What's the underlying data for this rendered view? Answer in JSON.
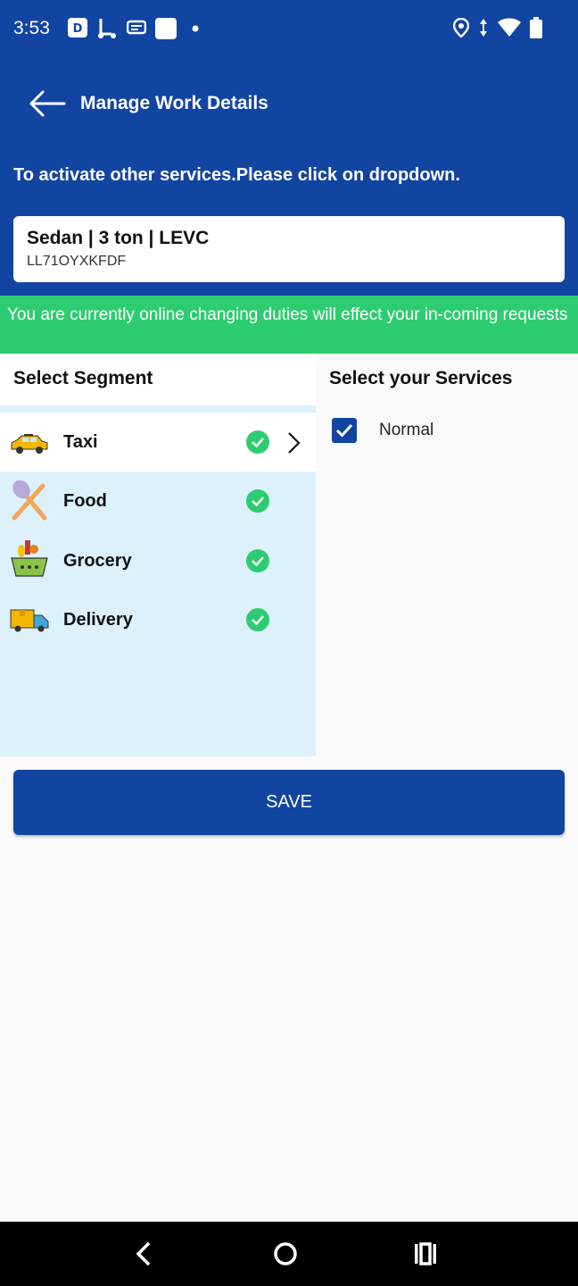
{
  "status_bar": {
    "time": "3:53",
    "icons": [
      "notification-p-icon",
      "scooter-icon",
      "message-icon",
      "square-icon",
      "dot-icon",
      "location-icon",
      "data-arrows-icon",
      "wifi-icon",
      "battery-icon"
    ]
  },
  "header": {
    "title": "Manage Work Details",
    "instruction": "To activate other services.Please click on dropdown."
  },
  "vehicle": {
    "name": "Sedan | 3 ton | LEVC",
    "plate": "LL71OYXKFDF"
  },
  "banner": {
    "text": "You are currently online changing duties will effect your in-coming requests"
  },
  "segments": {
    "heading": "Select Segment",
    "items": [
      {
        "label": "Taxi",
        "icon": "taxi-icon",
        "checked": true,
        "active": true
      },
      {
        "label": "Food",
        "icon": "food-icon",
        "checked": true,
        "active": false
      },
      {
        "label": "Grocery",
        "icon": "grocery-icon",
        "checked": true,
        "active": false
      },
      {
        "label": "Delivery",
        "icon": "delivery-truck-icon",
        "checked": true,
        "active": false
      }
    ]
  },
  "services": {
    "heading": "Select your Services",
    "items": [
      {
        "label": "Normal",
        "checked": true
      }
    ]
  },
  "save_label": "SAVE",
  "colors": {
    "primary": "#1244a2",
    "success": "#2ecc71",
    "segment_bg": "#dcf1fc"
  }
}
